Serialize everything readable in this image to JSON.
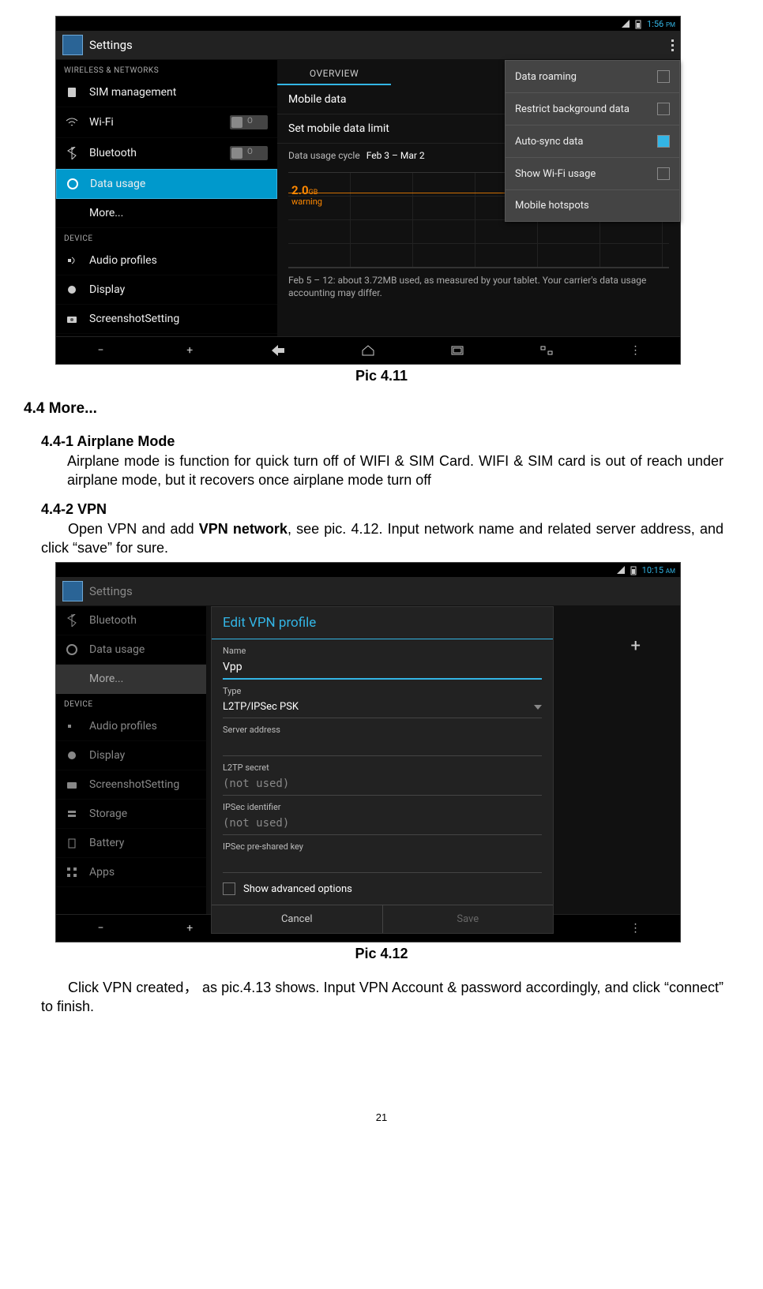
{
  "screenshot1": {
    "status": {
      "time": "1:56",
      "ampm": "PM"
    },
    "appbar_title": "Settings",
    "section_wireless": "WIRELESS & NETWORKS",
    "section_device": "DEVICE",
    "sidebar": {
      "sim": "SIM management",
      "wifi": "Wi-Fi",
      "wifi_toggle": "O",
      "bt": "Bluetooth",
      "bt_toggle": "O",
      "data": "Data usage",
      "more": "More...",
      "audio": "Audio profiles",
      "display": "Display",
      "screenshot": "ScreenshotSetting"
    },
    "content": {
      "overview_tab": "OVERVIEW",
      "mobile_data": "Mobile data",
      "limit": "Set mobile data limit",
      "cycle_label": "Data usage cycle",
      "cycle_value": "Feb 3 – Mar 2",
      "warning_value": "2.0",
      "warning_unit": "GB",
      "warning_word": "warning",
      "usage_note": "Feb 5 – 12: about 3.72MB used, as measured by your tablet. Your carrier's data usage accounting may differ."
    },
    "overflow": {
      "roaming": "Data roaming",
      "restrict": "Restrict background data",
      "autosync": "Auto-sync data",
      "wifi_usage": "Show Wi-Fi usage",
      "hotspots": "Mobile hotspots"
    },
    "chart_data": {
      "type": "line",
      "x_range": [
        "Feb 3",
        "Mar 2"
      ],
      "warning_level_gb": 2.0,
      "highlighted_range": [
        "Feb 5",
        "Feb 12"
      ],
      "highlighted_usage_mb": 3.72,
      "ylim": [
        0,
        2.2
      ]
    }
  },
  "caption1": "Pic 4.11",
  "doc": {
    "section_more": "4.4 More...",
    "airplane_heading": "4.4-1 Airplane Mode",
    "airplane_text": "Airplane mode is function for quick turn off of WIFI & SIM Card. WIFI & SIM card is out of reach under airplane mode, but it recovers once airplane mode turn off",
    "vpn_heading": "4.4-2 VPN",
    "vpn_text_pre": "Open VPN and add ",
    "vpn_text_bold": "VPN network",
    "vpn_text_post": ", see pic. 4.12. Input network name and related server address, and click “save” for sure."
  },
  "screenshot2": {
    "status": {
      "time": "10:15",
      "ampm": "AM"
    },
    "appbar_title": "Settings",
    "section_device": "DEVICE",
    "sidebar": {
      "bt": "Bluetooth",
      "data": "Data usage",
      "more": "More...",
      "audio": "Audio profiles",
      "display": "Display",
      "screenshot": "ScreenshotSetting",
      "storage": "Storage",
      "battery": "Battery",
      "apps": "Apps"
    },
    "dialog": {
      "title": "Edit VPN profile",
      "name_label": "Name",
      "name_value": "Vpp",
      "type_label": "Type",
      "type_value": "L2TP/IPSec PSK",
      "server_label": "Server address",
      "server_value": "",
      "l2tp_label": "L2TP secret",
      "l2tp_value": "(not used)",
      "ipsec_id_label": "IPSec identifier",
      "ipsec_id_value": "(not used)",
      "ipsec_key_label": "IPSec pre-shared key",
      "advanced": "Show advanced options",
      "cancel": "Cancel",
      "save": "Save"
    },
    "plus": "+"
  },
  "caption2": "Pic 4.12",
  "after_text": "Click VPN created， as pic.4.13 shows. Input VPN Account & password accordingly, and click “connect” to finish.",
  "page_no": "21"
}
